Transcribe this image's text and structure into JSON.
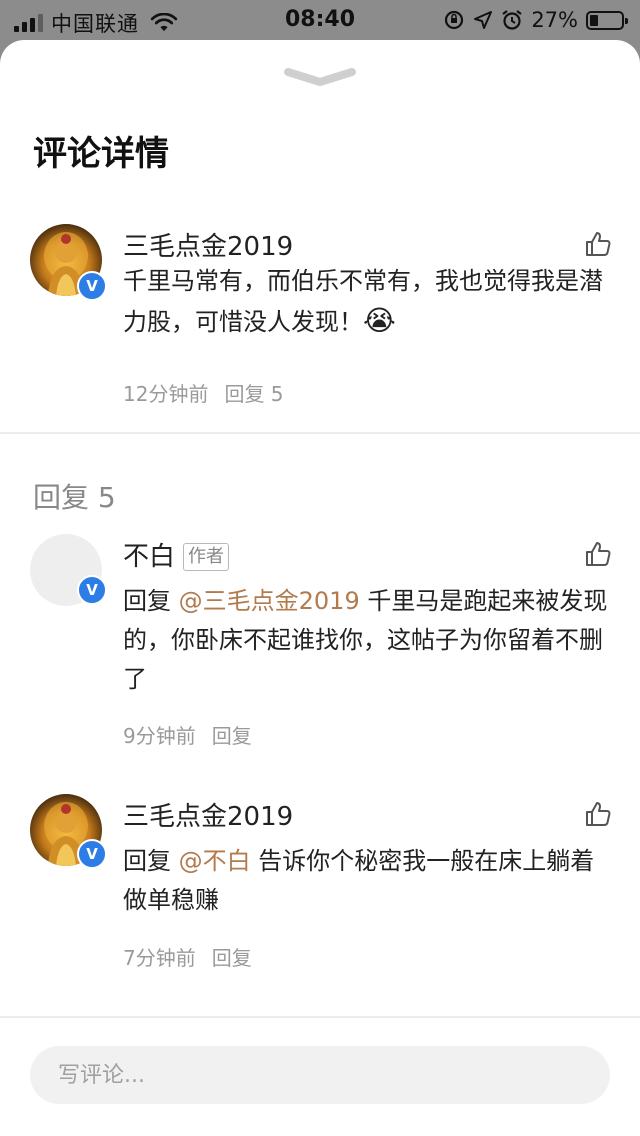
{
  "status_bar": {
    "carrier": "中国联通",
    "time": "08:40",
    "battery": "27%",
    "icons": [
      "signal-icon",
      "wifi-icon",
      "rotation-lock-icon",
      "location-icon",
      "alarm-icon",
      "battery-icon"
    ]
  },
  "sheet": {
    "title": "评论详情",
    "handle_icon": "chevron-down-icon"
  },
  "main_comment": {
    "author": "三毛点金2019",
    "text": "千里马常有，而伯乐不常有，我也觉得我是潜力股，可惜没人发现！",
    "emoji": "😭",
    "time": "12分钟前",
    "reply_label": "回复 5",
    "verified_icon": "verified-badge-icon",
    "like_icon": "thumbs-up-icon"
  },
  "replies_section": {
    "label": "回复 5"
  },
  "replies": [
    {
      "author": "不白",
      "tag": "作者",
      "prefix": "回复",
      "mention": "@三毛点金2019",
      "text": "千里马是跑起来被发现的，你卧床不起谁找你，这帖子为你留着不删了",
      "time": "9分钟前",
      "reply_label": "回复"
    },
    {
      "author": "三毛点金2019",
      "prefix": "回复",
      "mention": "@不白",
      "text": "告诉你个秘密我一般在床上躺着做单稳赚",
      "time": "7分钟前",
      "reply_label": "回复"
    }
  ],
  "composer": {
    "placeholder": "写评论..."
  },
  "colors": {
    "mention": "#b37a4c",
    "verified_badge": "#2c7de6",
    "muted_text": "#9a9a9a",
    "overlay_bg": "#8c8c8c"
  }
}
